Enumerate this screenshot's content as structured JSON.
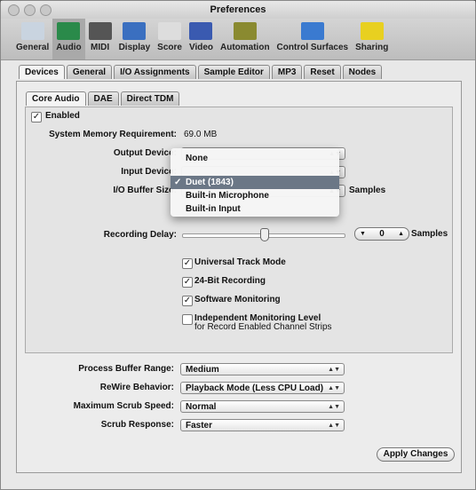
{
  "window": {
    "title": "Preferences"
  },
  "toolbar": [
    {
      "label": "General",
      "color": "#c9d4e0"
    },
    {
      "label": "Audio",
      "color": "#2a8a4a"
    },
    {
      "label": "MIDI",
      "color": "#555"
    },
    {
      "label": "Display",
      "color": "#3a6fc0"
    },
    {
      "label": "Score",
      "color": "#ddd"
    },
    {
      "label": "Video",
      "color": "#3a5ab0"
    },
    {
      "label": "Automation",
      "color": "#8a8a30"
    },
    {
      "label": "Control Surfaces",
      "color": "#3a7ad0"
    },
    {
      "label": "Sharing",
      "color": "#e8d020"
    }
  ],
  "tabs": [
    "Devices",
    "General",
    "I/O Assignments",
    "Sample Editor",
    "MP3",
    "Reset",
    "Nodes"
  ],
  "subtabs": [
    "Core Audio",
    "DAE",
    "Direct TDM"
  ],
  "core": {
    "enabled": "Enabled",
    "mem_label": "System Memory Requirement:",
    "mem_value": "69.0 MB",
    "output_label": "Output Device:",
    "input_label": "Input Device:",
    "buffer_label": "I/O Buffer Size:",
    "buffer_unit": "Samples",
    "rec_delay_label": "Recording Delay:",
    "rec_delay_value": "0",
    "rec_delay_unit": "Samples",
    "rec_delay_fraction": 0.5,
    "checks": [
      {
        "label": "Universal Track Mode",
        "checked": true
      },
      {
        "label": "24-Bit Recording",
        "checked": true
      },
      {
        "label": "Software Monitoring",
        "checked": true
      },
      {
        "label": "Independent Monitoring Level",
        "checked": false
      }
    ],
    "indep_sub": "for Record Enabled Channel Strips"
  },
  "menu": {
    "items": [
      "None",
      "Duet (1843)",
      "Built-in Microphone",
      "Built-in Input"
    ],
    "selected": "Duet (1843)",
    "check": "✓"
  },
  "bottom": [
    {
      "label": "Process Buffer Range:",
      "value": "Medium"
    },
    {
      "label": "ReWire Behavior:",
      "value": "Playback Mode (Less CPU Load)"
    },
    {
      "label": "Maximum Scrub Speed:",
      "value": "Normal"
    },
    {
      "label": "Scrub Response:",
      "value": "Faster"
    }
  ],
  "apply": "Apply Changes"
}
